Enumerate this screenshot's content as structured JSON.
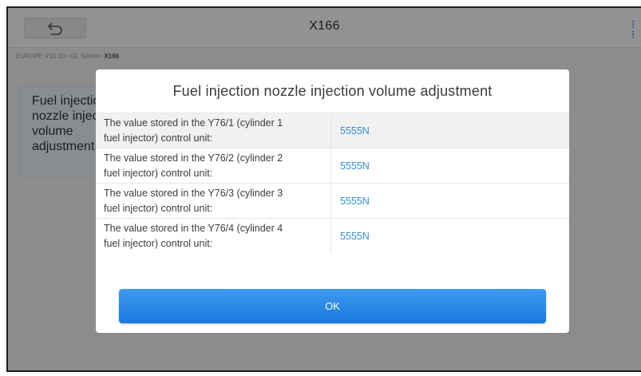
{
  "header": {
    "title": "X166",
    "back_icon": "back-arrow-icon",
    "corner_icon": "menu-icon"
  },
  "breadcrumb": {
    "path": "EUROPE V10.10> GL Series> ",
    "current": "X166"
  },
  "side_card": {
    "text_lines": [
      "Fuel injection",
      "nozzle injection",
      "volume",
      "adjustment"
    ]
  },
  "dialog": {
    "title": "Fuel injection nozzle injection volume adjustment",
    "rows": [
      {
        "label_line1": "The value stored in the Y76/1 (cylinder 1",
        "label_line2": "fuel injector) control unit:",
        "value": "5555N"
      },
      {
        "label_line1": "The value stored in the Y76/2 (cylinder 2",
        "label_line2": "fuel injector) control unit:",
        "value": "5555N"
      },
      {
        "label_line1": "The value stored in the Y76/3 (cylinder 3",
        "label_line2": "fuel injector) control unit:",
        "value": "5555N"
      },
      {
        "label_line1": "The value stored in the Y76/4 (cylinder 4",
        "label_line2": "fuel injector) control unit:",
        "value": "5555N"
      }
    ],
    "ok_label": "OK"
  },
  "colors": {
    "accent": "#1877de",
    "value_text": "#2f8fd8"
  }
}
